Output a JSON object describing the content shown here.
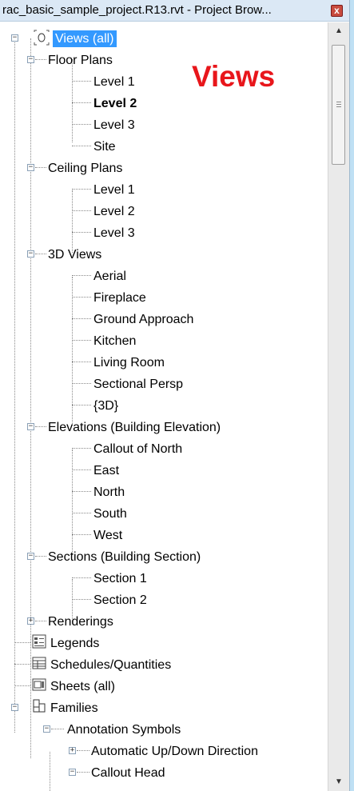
{
  "window": {
    "title": "rac_basic_sample_project.R13.rvt - Project Brow...",
    "close_glyph": "x"
  },
  "watermark": "Views",
  "tree": {
    "root": {
      "label": "Views (all)",
      "expander": "−"
    },
    "floor_plans": {
      "label": "Floor Plans",
      "items": [
        "Level 1",
        "Level 2",
        "Level 3",
        "Site"
      ]
    },
    "ceiling_plans": {
      "label": "Ceiling Plans",
      "items": [
        "Level 1",
        "Level 2",
        "Level 3"
      ]
    },
    "views_3d": {
      "label": "3D Views",
      "items": [
        "Aerial",
        "Fireplace",
        "Ground Approach",
        "Kitchen",
        "Living Room",
        "Sectional Persp",
        "{3D}"
      ]
    },
    "elevations": {
      "label": "Elevations (Building Elevation)",
      "items": [
        "Callout of North",
        "East",
        "North",
        "South",
        "West"
      ]
    },
    "sections": {
      "label": "Sections (Building Section)",
      "items": [
        "Section 1",
        "Section 2"
      ]
    },
    "renderings": {
      "label": "Renderings",
      "expander": "+"
    },
    "legends": {
      "label": "Legends"
    },
    "schedules": {
      "label": "Schedules/Quantities"
    },
    "sheets": {
      "label": "Sheets (all)"
    },
    "families": {
      "label": "Families"
    },
    "annotation_symbols": {
      "label": "Annotation Symbols"
    },
    "auto_updown": {
      "label": "Automatic Up/Down Direction",
      "expander": "+"
    },
    "callout_head": {
      "label": "Callout Head"
    }
  },
  "selected_item": "Level 2",
  "colors": {
    "selection": "#3399ff",
    "watermark": "#e8161b",
    "titlebar": "#dbe8f5"
  },
  "icons": {
    "root": "view-group-icon",
    "legends": "legend-icon",
    "schedules": "schedule-icon",
    "sheets": "sheet-icon",
    "families": "family-icon"
  }
}
